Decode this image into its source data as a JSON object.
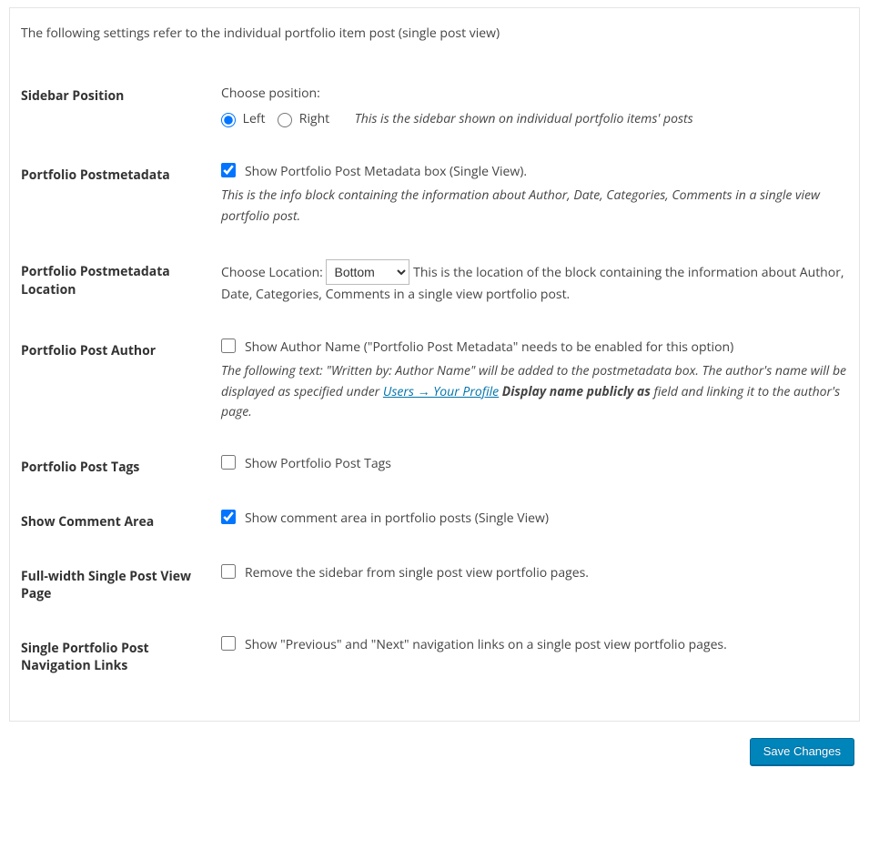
{
  "intro": "The following settings refer to the individual portfolio item post (single post view)",
  "rows": {
    "sidebar_position": {
      "label": "Sidebar Position",
      "choose": "Choose position:",
      "left": "Left",
      "right": "Right",
      "note": "This is the sidebar shown on individual portfolio items' posts"
    },
    "postmeta": {
      "label": "Portfolio Postmetadata",
      "check": "Show Portfolio Post Metadata box (Single View).",
      "note": "This is the info block containing the information about Author, Date, Categories, Comments in a single view portfolio post."
    },
    "postmeta_loc": {
      "label": "Portfolio Postmetadata Location",
      "choose": "Choose Location:",
      "selected": "Bottom",
      "after": "This is the location of the block containing the information about Author, Date, Categories, Comments in a single view portfolio post."
    },
    "author": {
      "label": "Portfolio Post Author",
      "check": "Show Author Name (\"Portfolio Post Metadata\" needs to be enabled for this option)",
      "note_pre": "The following text: \"Written by: Author Name\" will be added to the postmetadata box. The author's name will be displayed as specified under ",
      "link": "Users → Your Profile",
      "strong_part": " Display name publicly as ",
      "note_post": "field and linking it to the author's page."
    },
    "tags": {
      "label": "Portfolio Post Tags",
      "check": "Show Portfolio Post Tags"
    },
    "comments": {
      "label": "Show Comment Area",
      "check": "Show comment area in portfolio posts (Single View)"
    },
    "fullwidth": {
      "label": "Full-width Single Post View Page",
      "check": "Remove the sidebar from single post view portfolio pages."
    },
    "navlinks": {
      "label": "Single Portfolio Post Navigation Links",
      "check": "Show \"Previous\" and \"Next\" navigation links on a single post view portfolio pages."
    }
  },
  "save_button": "Save Changes"
}
